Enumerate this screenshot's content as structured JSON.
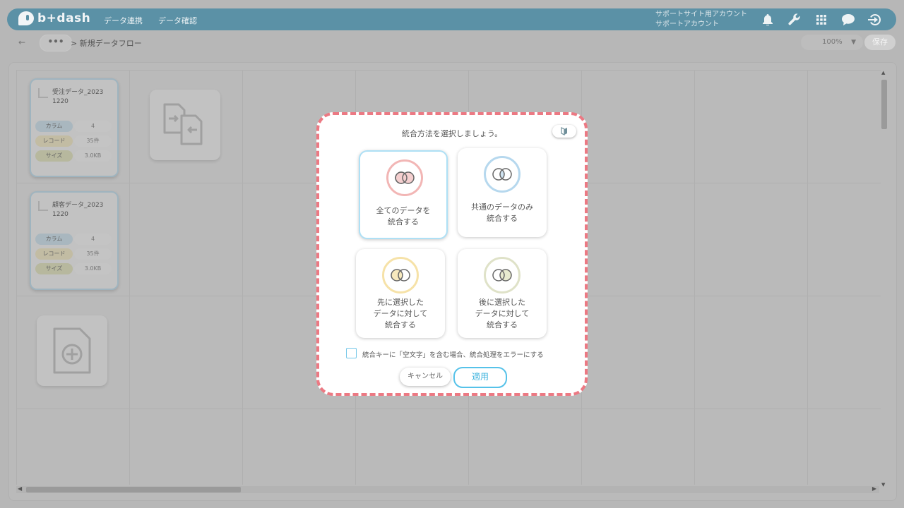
{
  "header": {
    "logo_text": "b+dash",
    "nav": [
      "データ連携",
      "データ確認"
    ],
    "account_line1": "サポートサイト用アカウント",
    "account_line2": "サポートアカウント",
    "icons": [
      "bell-icon",
      "wrench-icon",
      "grid-icon",
      "chat-icon",
      "logout-icon"
    ]
  },
  "subbar": {
    "back": "←",
    "more": "•••",
    "breadcrumb": "> 新規データフロー",
    "zoom": "100%",
    "save": "保存"
  },
  "files": [
    {
      "name": "受注データ_2023\n1220",
      "rows": [
        {
          "key": "カラム",
          "value": "4"
        },
        {
          "key": "レコード",
          "value": "35件"
        },
        {
          "key": "サイズ",
          "value": "3.0KB"
        }
      ]
    },
    {
      "name": "顧客データ_2023\n1220",
      "rows": [
        {
          "key": "カラム",
          "value": "4"
        },
        {
          "key": "レコード",
          "value": "35件"
        },
        {
          "key": "サイズ",
          "value": "3.0KB"
        }
      ]
    }
  ],
  "modal": {
    "title": "統合方法を選択しましょう。",
    "options": [
      {
        "line1": "全てのデータを",
        "line2": "統合する",
        "line3": "",
        "color": "#f2b6b5",
        "selected": true
      },
      {
        "line1": "共通のデータのみ",
        "line2": "統合する",
        "line3": "",
        "color": "#b6d8ee",
        "selected": false
      },
      {
        "line1": "先に選択した",
        "line2": "データに対して",
        "line3": "統合する",
        "color": "#f6e2a8",
        "selected": false
      },
      {
        "line1": "後に選択した",
        "line2": "データに対して",
        "line3": "統合する",
        "color": "#dfe2c8",
        "selected": false
      }
    ],
    "checkbox_label": "統合キーに「空文字」を含む場合、統合処理をエラーにする",
    "checkbox_checked": false,
    "cancel": "キャンセル",
    "apply": "適用"
  }
}
